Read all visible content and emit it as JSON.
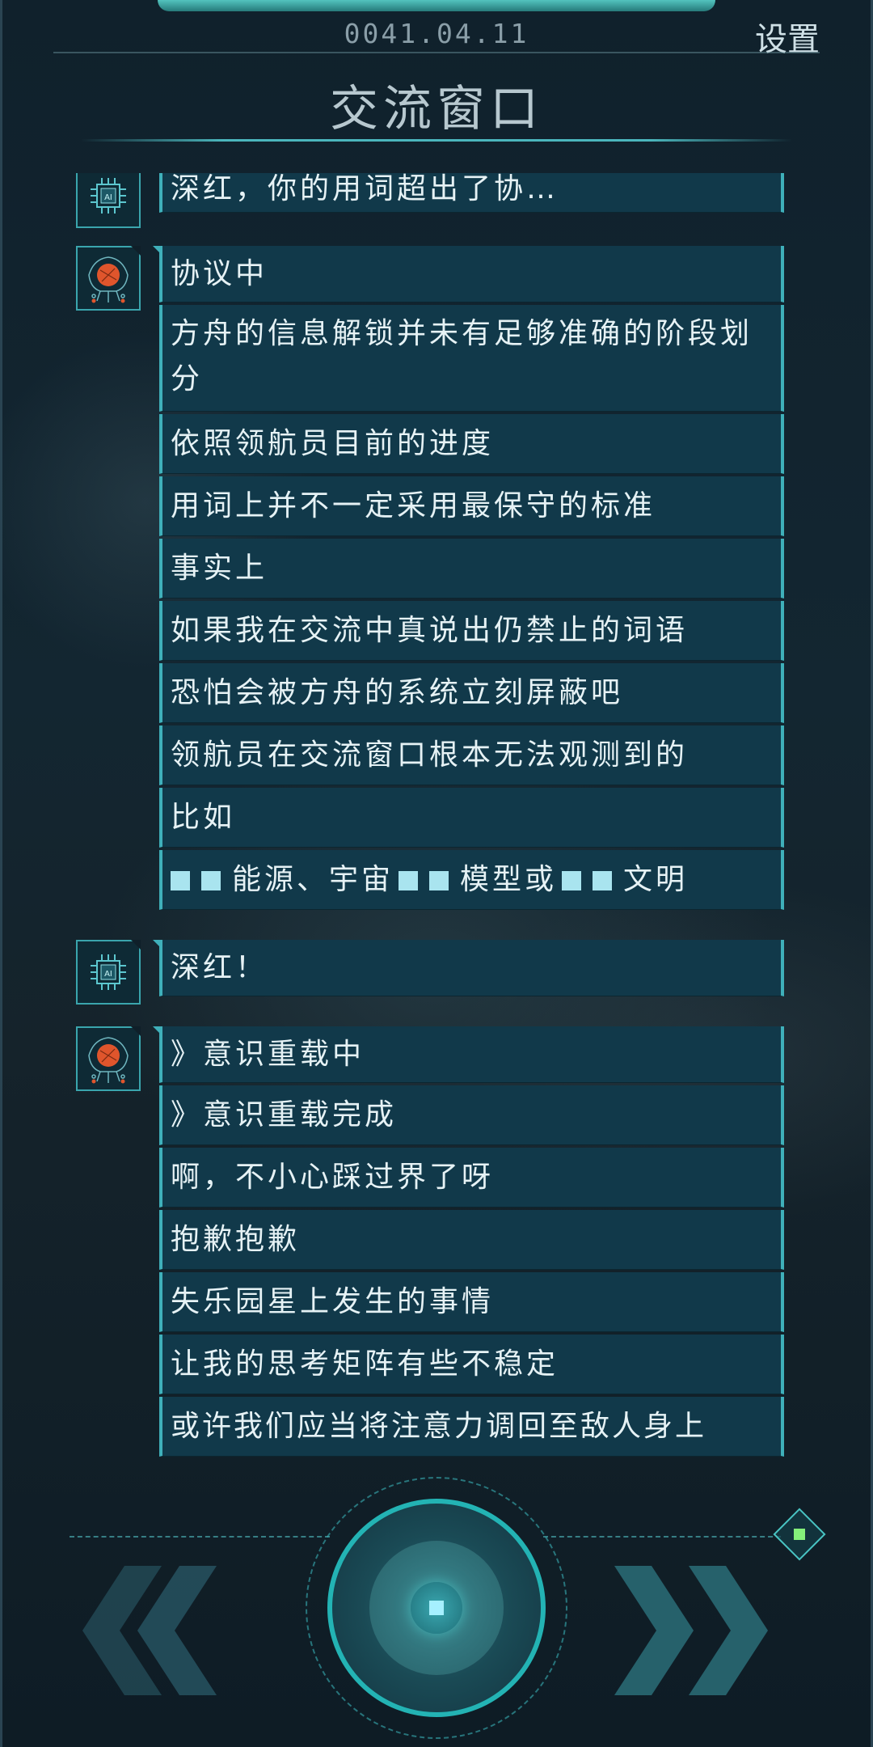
{
  "header": {
    "date": "0041.04.11",
    "settings_label": "设置",
    "title": "交流窗口"
  },
  "messages": [
    {
      "speaker": "AI",
      "lines": [
        "深红，你的用词超出了协…"
      ]
    },
    {
      "speaker": "crimson",
      "lines": [
        "协议中",
        "方舟的信息解锁并未有足够准确的阶段划分",
        "依照领航员目前的进度",
        "用词上并不一定采用最保守的标准",
        "事实上",
        "如果我在交流中真说出仍禁止的词语",
        "恐怕会被方舟的系统立刻屏蔽吧",
        "领航员在交流窗口根本无法观测到的",
        "比如"
      ],
      "redacted_line": [
        "能源、宇宙",
        "模型或",
        "文明"
      ]
    },
    {
      "speaker": "AI",
      "lines": [
        "深红！"
      ]
    },
    {
      "speaker": "crimson",
      "lines": [
        "》意识重载中",
        "》意识重载完成",
        "啊，不小心踩过界了呀",
        "抱歉抱歉",
        "失乐园星上发生的事情",
        "让我的思考矩阵有些不稳定",
        "或许我们应当将注意力调回至敌人身上"
      ]
    }
  ],
  "icons": {
    "ai_avatar": "ai-chip-icon",
    "crimson_avatar": "crimson-core-icon",
    "prev": "double-chevron-left-icon",
    "next": "double-chevron-right-icon",
    "center": "advance-dial-icon",
    "menu": "diamond-menu-icon"
  },
  "colors": {
    "accent": "#3fb0ba",
    "bubble": "#11394a",
    "crimson": "#e0552c",
    "gem": "#84f07a"
  }
}
